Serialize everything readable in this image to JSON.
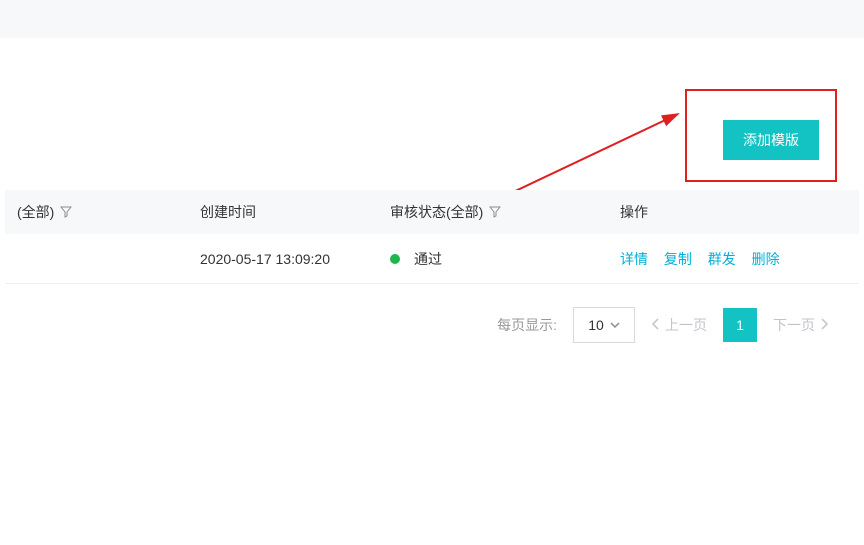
{
  "actions": {
    "add_template_label": "添加模版"
  },
  "table": {
    "headers": {
      "type": "(全部)",
      "created_at": "创建时间",
      "status": "审核状态(全部)",
      "ops": "操作"
    },
    "rows": [
      {
        "created_at": "2020-05-17 13:09:20",
        "status_text": "通过",
        "status_color": "#1fb74c",
        "ops": {
          "detail": "详情",
          "copy": "复制",
          "bulk": "群发",
          "delete": "删除"
        }
      }
    ]
  },
  "pagination": {
    "per_page_label": "每页显示:",
    "page_size": "10",
    "prev_label": "上一页",
    "next_label": "下一页",
    "current_page": "1"
  }
}
